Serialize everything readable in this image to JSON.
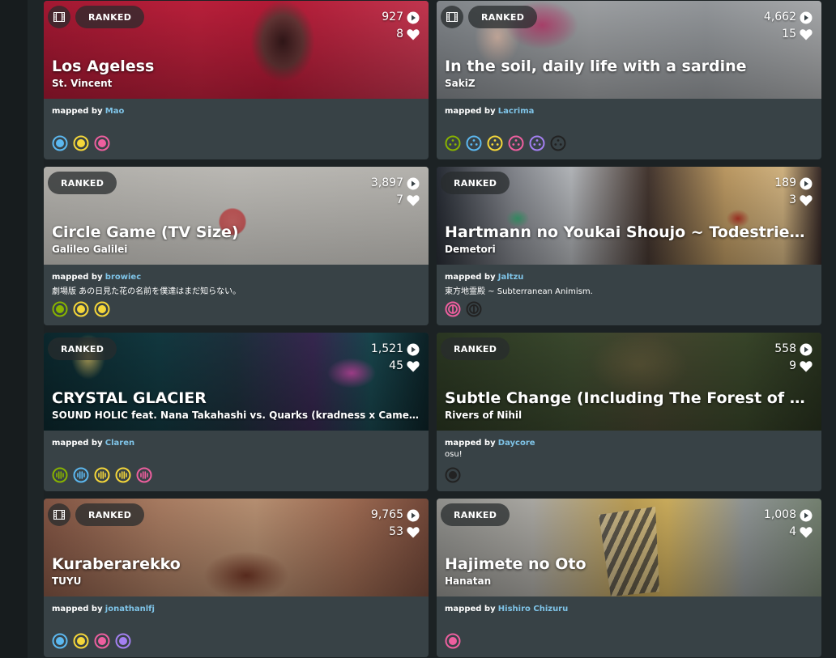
{
  "labels": {
    "ranked": "RANKED",
    "mapped_by": "mapped by"
  },
  "cards": [
    {
      "title": "Los Ageless",
      "artist": "St. Vincent",
      "plays": "927",
      "favs": "8",
      "mapper": "Mao",
      "source": "",
      "video": true,
      "mode": "osu",
      "diffs": [
        "#5cb8f0",
        "#f5d73a",
        "#ee5f9f"
      ]
    },
    {
      "title": "In the soil, daily life with a sardine",
      "artist": "SakiZ",
      "plays": "4,662",
      "favs": "15",
      "mapper": "Lacrima",
      "source": "",
      "video": true,
      "mode": "osu",
      "diffs": [
        "#88b300",
        "#5cb8f0",
        "#f5d73a",
        "#ee5f9f",
        "#a480f2",
        "#222222"
      ]
    },
    {
      "title": "Circle Game (TV Size)",
      "artist": "Galileo Galilei",
      "plays": "3,897",
      "favs": "7",
      "mapper": "browiec",
      "source": "劇場版 あの日見た花の名前を僕達はまだ知らない。",
      "video": false,
      "mode": "osu",
      "diffs": [
        "#88b300",
        "#f5d73a",
        "#f5d73a"
      ]
    },
    {
      "title": "Hartmann no Youkai Shoujo ~ Todestrieb und...",
      "artist": "Demetori",
      "plays": "189",
      "favs": "3",
      "mapper": "Jaltzu",
      "source": "東方地霊殿 ~ Subterranean Animism.",
      "video": false,
      "mode": "taiko",
      "diffs": [
        "#ee5f9f",
        "#222222"
      ]
    },
    {
      "title": "CRYSTAL GLACIER",
      "artist": "SOUND HOLIC feat. Nana Takahashi vs. Quarks (kradness x Camellia)",
      "plays": "1,521",
      "favs": "45",
      "mapper": "Claren",
      "source": "",
      "video": false,
      "mode": "mania",
      "diffs": [
        "#88b300",
        "#5cb8f0",
        "#f5d73a",
        "#f5d73a",
        "#ee5f9f"
      ]
    },
    {
      "title": "Subtle Change (Including The Forest of Transi...",
      "artist": "Rivers of Nihil",
      "plays": "558",
      "favs": "9",
      "mapper": "Daycore",
      "source": "osu!",
      "video": false,
      "mode": "osu",
      "diffs": [
        "#222222"
      ]
    },
    {
      "title": "Kuraberarekko",
      "artist": "TUYU",
      "plays": "9,765",
      "favs": "53",
      "mapper": "jonathanlfj",
      "source": "",
      "video": true,
      "mode": "osu",
      "diffs": [
        "#5cb8f0",
        "#f5d73a",
        "#ee5f9f",
        "#a480f2"
      ]
    },
    {
      "title": "Hajimete no Oto",
      "artist": "Hanatan",
      "plays": "1,008",
      "favs": "4",
      "mapper": "Hishiro Chizuru",
      "source": "",
      "video": false,
      "mode": "osu",
      "diffs": [
        "#ee5f9f"
      ]
    }
  ]
}
